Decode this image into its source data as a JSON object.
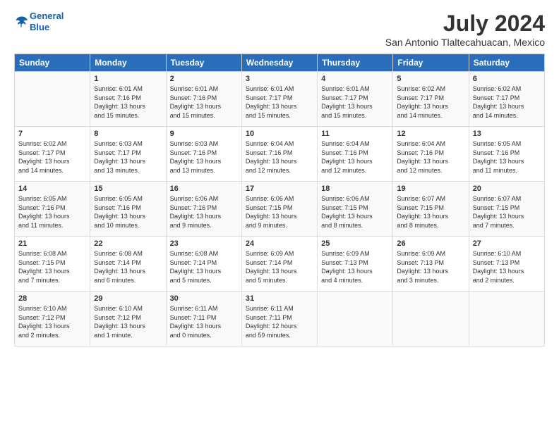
{
  "header": {
    "logo_line1": "General",
    "logo_line2": "Blue",
    "title": "July 2024",
    "subtitle": "San Antonio Tlaltecahuacan, Mexico"
  },
  "days_of_week": [
    "Sunday",
    "Monday",
    "Tuesday",
    "Wednesday",
    "Thursday",
    "Friday",
    "Saturday"
  ],
  "weeks": [
    [
      {
        "day": "",
        "lines": []
      },
      {
        "day": "1",
        "lines": [
          "Sunrise: 6:01 AM",
          "Sunset: 7:16 PM",
          "Daylight: 13 hours",
          "and 15 minutes."
        ]
      },
      {
        "day": "2",
        "lines": [
          "Sunrise: 6:01 AM",
          "Sunset: 7:16 PM",
          "Daylight: 13 hours",
          "and 15 minutes."
        ]
      },
      {
        "day": "3",
        "lines": [
          "Sunrise: 6:01 AM",
          "Sunset: 7:17 PM",
          "Daylight: 13 hours",
          "and 15 minutes."
        ]
      },
      {
        "day": "4",
        "lines": [
          "Sunrise: 6:01 AM",
          "Sunset: 7:17 PM",
          "Daylight: 13 hours",
          "and 15 minutes."
        ]
      },
      {
        "day": "5",
        "lines": [
          "Sunrise: 6:02 AM",
          "Sunset: 7:17 PM",
          "Daylight: 13 hours",
          "and 14 minutes."
        ]
      },
      {
        "day": "6",
        "lines": [
          "Sunrise: 6:02 AM",
          "Sunset: 7:17 PM",
          "Daylight: 13 hours",
          "and 14 minutes."
        ]
      }
    ],
    [
      {
        "day": "7",
        "lines": [
          "Sunrise: 6:02 AM",
          "Sunset: 7:17 PM",
          "Daylight: 13 hours",
          "and 14 minutes."
        ]
      },
      {
        "day": "8",
        "lines": [
          "Sunrise: 6:03 AM",
          "Sunset: 7:17 PM",
          "Daylight: 13 hours",
          "and 13 minutes."
        ]
      },
      {
        "day": "9",
        "lines": [
          "Sunrise: 6:03 AM",
          "Sunset: 7:16 PM",
          "Daylight: 13 hours",
          "and 13 minutes."
        ]
      },
      {
        "day": "10",
        "lines": [
          "Sunrise: 6:04 AM",
          "Sunset: 7:16 PM",
          "Daylight: 13 hours",
          "and 12 minutes."
        ]
      },
      {
        "day": "11",
        "lines": [
          "Sunrise: 6:04 AM",
          "Sunset: 7:16 PM",
          "Daylight: 13 hours",
          "and 12 minutes."
        ]
      },
      {
        "day": "12",
        "lines": [
          "Sunrise: 6:04 AM",
          "Sunset: 7:16 PM",
          "Daylight: 13 hours",
          "and 12 minutes."
        ]
      },
      {
        "day": "13",
        "lines": [
          "Sunrise: 6:05 AM",
          "Sunset: 7:16 PM",
          "Daylight: 13 hours",
          "and 11 minutes."
        ]
      }
    ],
    [
      {
        "day": "14",
        "lines": [
          "Sunrise: 6:05 AM",
          "Sunset: 7:16 PM",
          "Daylight: 13 hours",
          "and 11 minutes."
        ]
      },
      {
        "day": "15",
        "lines": [
          "Sunrise: 6:05 AM",
          "Sunset: 7:16 PM",
          "Daylight: 13 hours",
          "and 10 minutes."
        ]
      },
      {
        "day": "16",
        "lines": [
          "Sunrise: 6:06 AM",
          "Sunset: 7:16 PM",
          "Daylight: 13 hours",
          "and 9 minutes."
        ]
      },
      {
        "day": "17",
        "lines": [
          "Sunrise: 6:06 AM",
          "Sunset: 7:15 PM",
          "Daylight: 13 hours",
          "and 9 minutes."
        ]
      },
      {
        "day": "18",
        "lines": [
          "Sunrise: 6:06 AM",
          "Sunset: 7:15 PM",
          "Daylight: 13 hours",
          "and 8 minutes."
        ]
      },
      {
        "day": "19",
        "lines": [
          "Sunrise: 6:07 AM",
          "Sunset: 7:15 PM",
          "Daylight: 13 hours",
          "and 8 minutes."
        ]
      },
      {
        "day": "20",
        "lines": [
          "Sunrise: 6:07 AM",
          "Sunset: 7:15 PM",
          "Daylight: 13 hours",
          "and 7 minutes."
        ]
      }
    ],
    [
      {
        "day": "21",
        "lines": [
          "Sunrise: 6:08 AM",
          "Sunset: 7:15 PM",
          "Daylight: 13 hours",
          "and 7 minutes."
        ]
      },
      {
        "day": "22",
        "lines": [
          "Sunrise: 6:08 AM",
          "Sunset: 7:14 PM",
          "Daylight: 13 hours",
          "and 6 minutes."
        ]
      },
      {
        "day": "23",
        "lines": [
          "Sunrise: 6:08 AM",
          "Sunset: 7:14 PM",
          "Daylight: 13 hours",
          "and 5 minutes."
        ]
      },
      {
        "day": "24",
        "lines": [
          "Sunrise: 6:09 AM",
          "Sunset: 7:14 PM",
          "Daylight: 13 hours",
          "and 5 minutes."
        ]
      },
      {
        "day": "25",
        "lines": [
          "Sunrise: 6:09 AM",
          "Sunset: 7:13 PM",
          "Daylight: 13 hours",
          "and 4 minutes."
        ]
      },
      {
        "day": "26",
        "lines": [
          "Sunrise: 6:09 AM",
          "Sunset: 7:13 PM",
          "Daylight: 13 hours",
          "and 3 minutes."
        ]
      },
      {
        "day": "27",
        "lines": [
          "Sunrise: 6:10 AM",
          "Sunset: 7:13 PM",
          "Daylight: 13 hours",
          "and 2 minutes."
        ]
      }
    ],
    [
      {
        "day": "28",
        "lines": [
          "Sunrise: 6:10 AM",
          "Sunset: 7:12 PM",
          "Daylight: 13 hours",
          "and 2 minutes."
        ]
      },
      {
        "day": "29",
        "lines": [
          "Sunrise: 6:10 AM",
          "Sunset: 7:12 PM",
          "Daylight: 13 hours",
          "and 1 minute."
        ]
      },
      {
        "day": "30",
        "lines": [
          "Sunrise: 6:11 AM",
          "Sunset: 7:11 PM",
          "Daylight: 13 hours",
          "and 0 minutes."
        ]
      },
      {
        "day": "31",
        "lines": [
          "Sunrise: 6:11 AM",
          "Sunset: 7:11 PM",
          "Daylight: 12 hours",
          "and 59 minutes."
        ]
      },
      {
        "day": "",
        "lines": []
      },
      {
        "day": "",
        "lines": []
      },
      {
        "day": "",
        "lines": []
      }
    ]
  ]
}
